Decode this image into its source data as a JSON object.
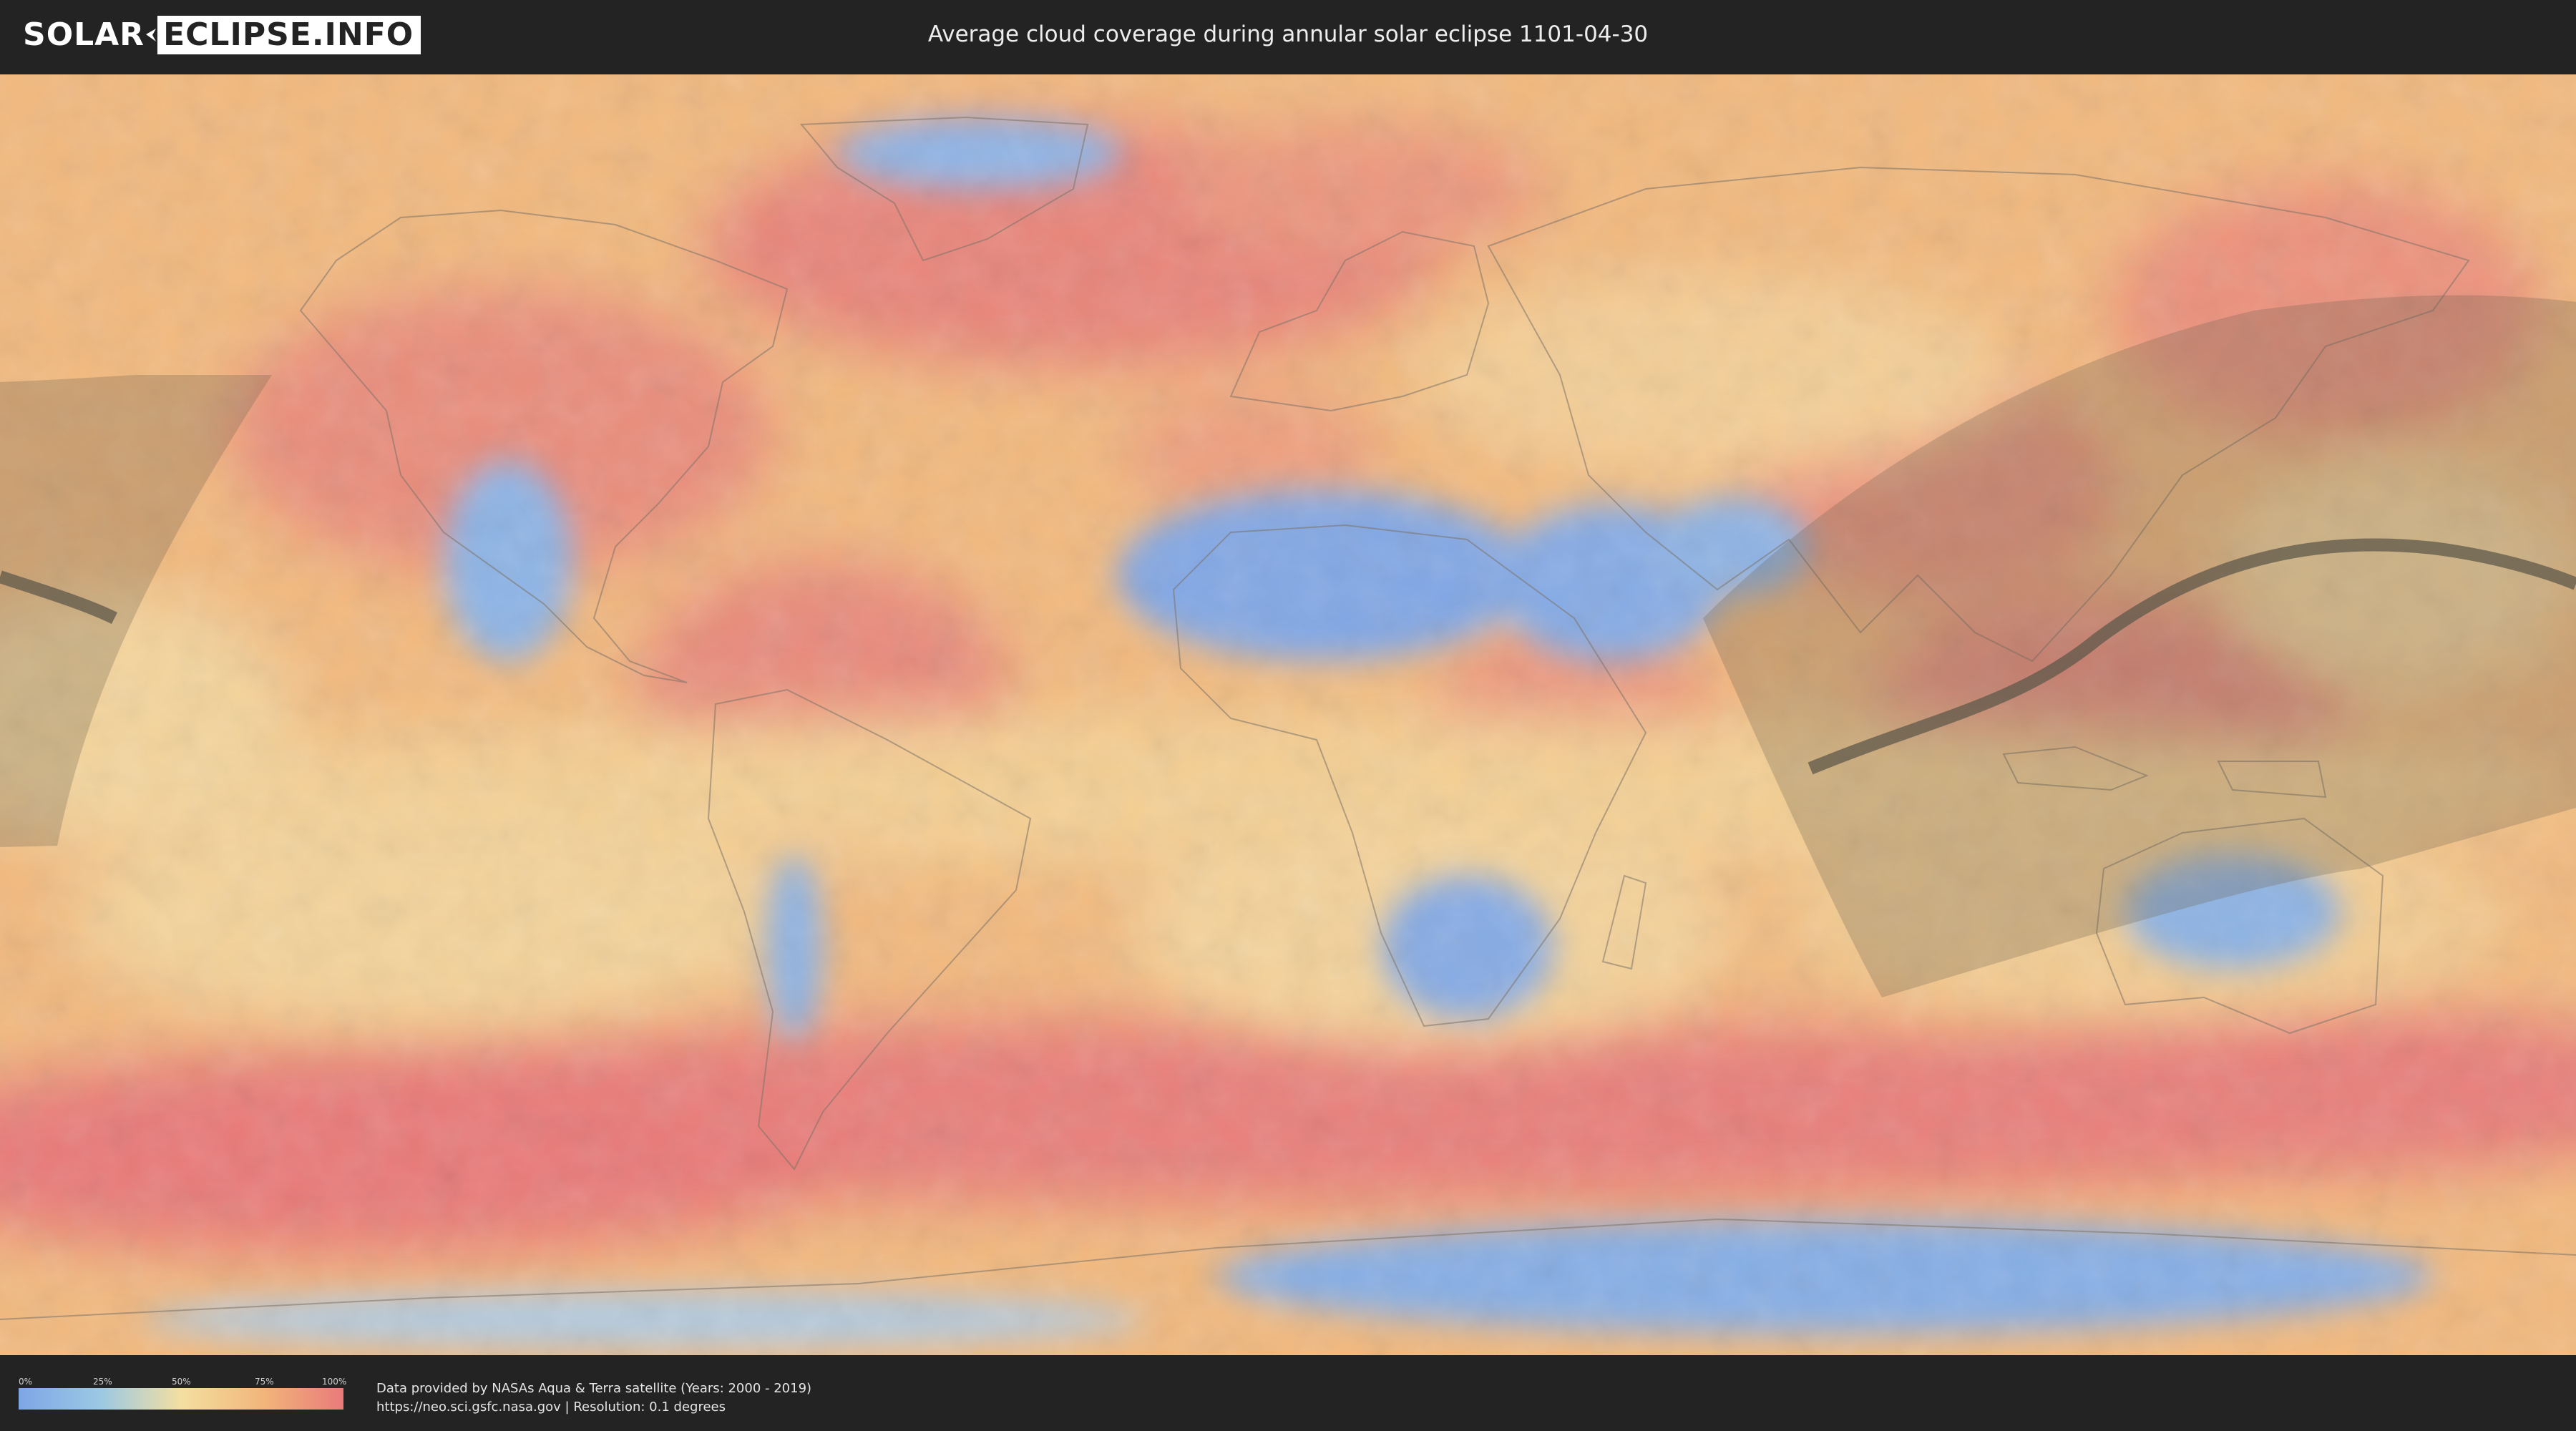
{
  "header": {
    "logo_left": "SOLAR",
    "logo_right": "ECLIPSE.INFO",
    "title": "Average cloud coverage during annular solar eclipse 1101-04-30"
  },
  "legend": {
    "ticks": [
      "0%",
      "25%",
      "50%",
      "75%",
      "100%"
    ],
    "colors": [
      "#7ea6e6",
      "#9bc8e4",
      "#f3dfa1",
      "#f2b67a",
      "#e97a7a"
    ]
  },
  "credits": {
    "line1": "Data provided by NASAs Aqua & Terra satellite (Years: 2000 - 2019)",
    "line2": "https://neo.sci.gsfc.nasa.gov | Resolution: 0.1 degrees"
  },
  "colors": {
    "background": "#232323",
    "clear": "#7ea6e6",
    "cloudy": "#e97a7a",
    "eclipse_path": "#6a604f"
  }
}
